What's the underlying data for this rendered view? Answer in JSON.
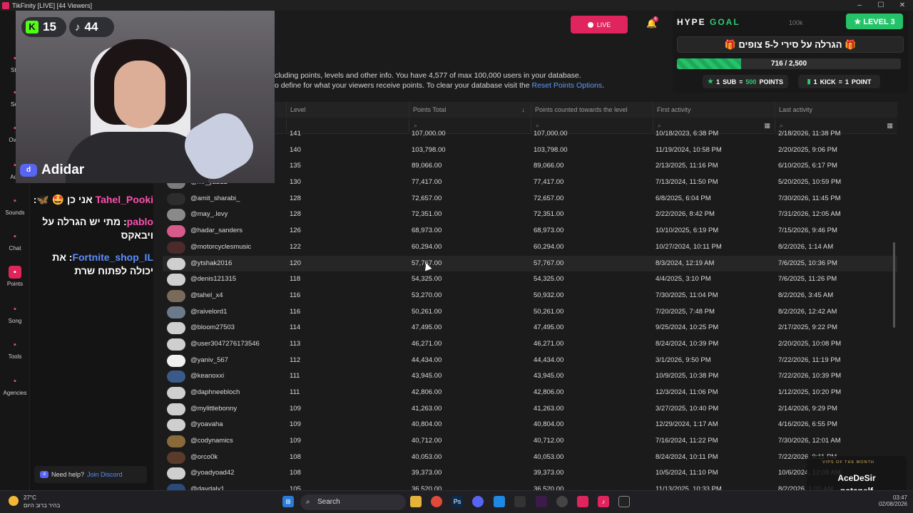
{
  "window": {
    "title": "TikFinity [LIVE] [44 Viewers]"
  },
  "nav": [
    {
      "label": "Sto",
      "icon": "home-icon"
    },
    {
      "label": "Set",
      "icon": "setup-icon"
    },
    {
      "label": "Over",
      "icon": "overlay-icon"
    },
    {
      "label": "Acti",
      "icon": "actions-icon"
    },
    {
      "label": "Sounds",
      "icon": "sounds-icon"
    },
    {
      "label": "Chat",
      "icon": "chat-icon"
    },
    {
      "label": "Points",
      "icon": "points-icon"
    },
    {
      "label": "Song",
      "icon": "song-icon"
    },
    {
      "label": "Tools",
      "icon": "tools-icon"
    },
    {
      "label": "Agencies",
      "icon": "agencies-icon"
    }
  ],
  "webcam": {
    "kick_count": "15",
    "tiktok_count": "44",
    "name": "Adidar"
  },
  "chat": [
    {
      "user": "Tahel_Pooki",
      "text": "אני כן 🤩 🦋:",
      "color": "pink"
    },
    {
      "user": "pablo",
      "text": "מתי יש הגרלה על ויבאקס",
      "color": "pink"
    },
    {
      "user": "Fortnite_shop_IL",
      "text": "את יכולה לפתוח שרת",
      "color": "blue"
    }
  ],
  "help": {
    "text": "Need help?",
    "link": "Join Discord"
  },
  "topbar": {
    "live_label": "LIVE",
    "bell_count": "6"
  },
  "hype": {
    "title_a": "HYPE ",
    "title_b": "GOAL",
    "level": "★ LEVEL 3",
    "coin": "100k",
    "goal": "🎁 הגרלה על סירי ל-5 צופים 🎁",
    "progress": "716 / 2,500",
    "progress_fraction": 0.286,
    "rule1": {
      "n": "1",
      "a": "SUB",
      "eq": "=",
      "v": "500",
      "b": "POINTS"
    },
    "rule2": {
      "n": "1",
      "a": "KICK",
      "eq": "=",
      "v": "1",
      "b": "POINT"
    }
  },
  "info": {
    "line1": "cluding points, levels and other info. You have 4,577 of max 100,000 users in your database.",
    "line2": "o define for what your viewers receive points. To clear your database visit the ",
    "link": "Reset Points Options",
    "end": "."
  },
  "table": {
    "headers": [
      "Level",
      "Points Total",
      "Points counted towards the level",
      "First activity",
      "Last activity"
    ],
    "rows": [
      {
        "user": "",
        "level": "141",
        "total": "107,000.00",
        "counted": "107,000.00",
        "first": "10/18/2023, 6:38 PM",
        "last": "2/18/2026, 11:38 PM"
      },
      {
        "user": "",
        "level": "140",
        "total": "103,798.00",
        "counted": "103,798.00",
        "first": "11/19/2024, 10:58 PM",
        "last": "2/20/2025, 9:06 PM"
      },
      {
        "user": "",
        "level": "135",
        "total": "89,066.00",
        "counted": "89,066.00",
        "first": "2/13/2025, 11:16 PM",
        "last": "6/10/2025, 6:17 PM"
      },
      {
        "user": "@mr_y2212",
        "level": "130",
        "total": "77,417.00",
        "counted": "77,417.00",
        "first": "7/13/2024, 11:50 PM",
        "last": "5/20/2025, 10:59 PM"
      },
      {
        "user": "@amit_sharabi_",
        "level": "128",
        "total": "72,657.00",
        "counted": "72,657.00",
        "first": "6/8/2025, 6:04 PM",
        "last": "7/30/2026, 11:45 PM"
      },
      {
        "user": "@may_.levy",
        "level": "128",
        "total": "72,351.00",
        "counted": "72,351.00",
        "first": "2/22/2026, 8:42 PM",
        "last": "7/31/2026, 12:05 AM"
      },
      {
        "user": "@hadar_sanders",
        "level": "126",
        "total": "68,973.00",
        "counted": "68,973.00",
        "first": "10/10/2025, 6:19 PM",
        "last": "7/15/2026, 9:46 PM"
      },
      {
        "user": "@motorcyclesmusic",
        "level": "122",
        "total": "60,294.00",
        "counted": "60,294.00",
        "first": "10/27/2024, 10:11 PM",
        "last": "8/2/2026, 1:14 AM"
      },
      {
        "user": "@ytshak2016",
        "level": "120",
        "total": "57,767.00",
        "counted": "57,767.00",
        "first": "8/3/2024, 12:19 AM",
        "last": "7/6/2025, 10:36 PM"
      },
      {
        "user": "@denis121315",
        "level": "118",
        "total": "54,325.00",
        "counted": "54,325.00",
        "first": "4/4/2025, 3:10 PM",
        "last": "7/6/2025, 11:26 PM"
      },
      {
        "user": "@tahel_x4",
        "level": "116",
        "total": "53,270.00",
        "counted": "50,932.00",
        "first": "7/30/2025, 11:04 PM",
        "last": "8/2/2026, 3:45 AM"
      },
      {
        "user": "@raivelord1",
        "level": "116",
        "total": "50,261.00",
        "counted": "50,261.00",
        "first": "7/20/2025, 7:48 PM",
        "last": "8/2/2026, 12:42 AM"
      },
      {
        "user": "@bloom27503",
        "level": "114",
        "total": "47,495.00",
        "counted": "47,495.00",
        "first": "9/25/2024, 10:25 PM",
        "last": "2/17/2025, 9:22 PM"
      },
      {
        "user": "@user3047276173546",
        "level": "113",
        "total": "46,271.00",
        "counted": "46,271.00",
        "first": "8/24/2024, 10:39 PM",
        "last": "2/20/2025, 10:08 PM"
      },
      {
        "user": "@yaniv_567",
        "level": "112",
        "total": "44,434.00",
        "counted": "44,434.00",
        "first": "3/1/2026, 9:50 PM",
        "last": "7/22/2026, 11:19 PM"
      },
      {
        "user": "@keanoxxi",
        "level": "111",
        "total": "43,945.00",
        "counted": "43,945.00",
        "first": "10/9/2025, 10:38 PM",
        "last": "7/22/2026, 10:39 PM"
      },
      {
        "user": "@daphneebloch",
        "level": "111",
        "total": "42,806.00",
        "counted": "42,806.00",
        "first": "12/3/2024, 11:06 PM",
        "last": "1/12/2025, 10:20 PM"
      },
      {
        "user": "@mylittlebonny",
        "level": "109",
        "total": "41,263.00",
        "counted": "41,263.00",
        "first": "3/27/2025, 10:40 PM",
        "last": "2/14/2026, 9:29 PM"
      },
      {
        "user": "@yoavaha",
        "level": "109",
        "total": "40,804.00",
        "counted": "40,804.00",
        "first": "12/29/2024, 1:17 AM",
        "last": "4/16/2026, 6:55 PM"
      },
      {
        "user": "@codynamics",
        "level": "109",
        "total": "40,712.00",
        "counted": "40,712.00",
        "first": "7/16/2024, 11:22 PM",
        "last": "7/30/2026, 12:01 AM"
      },
      {
        "user": "@orco0k",
        "level": "108",
        "total": "40,053.00",
        "counted": "40,053.00",
        "first": "8/24/2024, 10:11 PM",
        "last": "7/22/2026, 9:11 PM"
      },
      {
        "user": "@yoadyoad42",
        "level": "108",
        "total": "39,373.00",
        "counted": "39,373.00",
        "first": "10/5/2024, 11:10 PM",
        "last": "10/6/2024, 12:08 AM"
      },
      {
        "user": "@daydaly1",
        "level": "105",
        "total": "36,520.00",
        "counted": "36,520.00",
        "first": "11/13/2025, 10:33 PM",
        "last": "8/2/2026, 1:00 AM"
      }
    ]
  },
  "vip": {
    "title": "VIPS OF THE MONTH",
    "name1": "AceDeSir",
    "name2": "natanelf"
  },
  "taskbar": {
    "temp": "27°C",
    "weather": "בהיר ברוב היום",
    "search": "Search",
    "time": "03:47",
    "date": "02/08/2026"
  }
}
